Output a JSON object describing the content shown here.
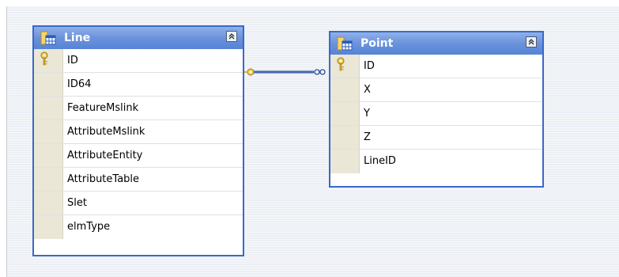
{
  "tables": {
    "line": {
      "title": "Line",
      "columns": [
        "ID",
        "ID64",
        "FeatureMslink",
        "AttributeMslink",
        "AttributeEntity",
        "AttributeTable",
        "Slet",
        "elmType"
      ],
      "primary_key_index": 0
    },
    "point": {
      "title": "Point",
      "columns": [
        "ID",
        "X",
        "Y",
        "Z",
        "LineID"
      ],
      "primary_key_index": 0
    }
  },
  "relationship": {
    "from_table": "Line",
    "from_end": "key-icon",
    "to_table": "Point",
    "to_end": "infinity-icon"
  },
  "colors": {
    "table_border": "#3a69c9",
    "header_top": "#8fb0e9",
    "header_bottom": "#5683d6",
    "row_gutter": "#eae7d6",
    "key_gold": "#e0b030",
    "relationship_line": "#2a4f9c",
    "canvas": "#eceff4"
  }
}
